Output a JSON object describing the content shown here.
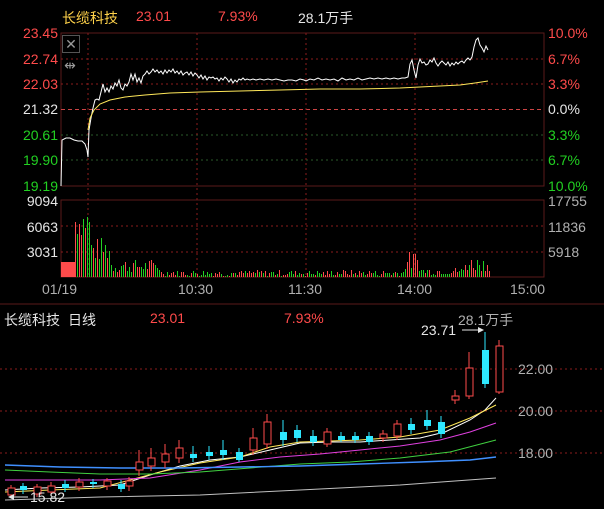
{
  "intraday": {
    "name": "长缆科技",
    "price": "23.01",
    "change_pct": "7.93%",
    "volume": "28.1万手",
    "price_labels": [
      "23.45",
      "22.74",
      "22.03",
      "21.32",
      "20.61",
      "19.90",
      "19.19"
    ],
    "pct_labels": [
      "10.0%",
      "6.7%",
      "3.3%",
      "0.0%",
      "3.3%",
      "6.7%",
      "10.0%"
    ],
    "vol_left_labels": [
      "9094",
      "6063",
      "3031"
    ],
    "vol_right_labels": [
      "17755",
      "11836",
      "5918"
    ],
    "time_labels": [
      "01/19",
      "10:30",
      "11:30",
      "14:00",
      "15:00"
    ],
    "icons": [
      "close-icon",
      "expand-arrows-icon"
    ]
  },
  "daily": {
    "name": "长缆科技",
    "period": "日线",
    "price": "23.01",
    "change_pct": "7.93%",
    "volume": "28.1万手",
    "price_labels": [
      "22.00",
      "20.00",
      "18.00"
    ],
    "high_marker": "23.71",
    "low_marker": "15.82"
  },
  "colors": {
    "up": "#ff4b4b",
    "down": "#22d022",
    "price_line": "#ffffff",
    "avg_line": "#ffe85a",
    "candle_down": "#2ee8ff",
    "grid": "#9b1c1c"
  }
}
